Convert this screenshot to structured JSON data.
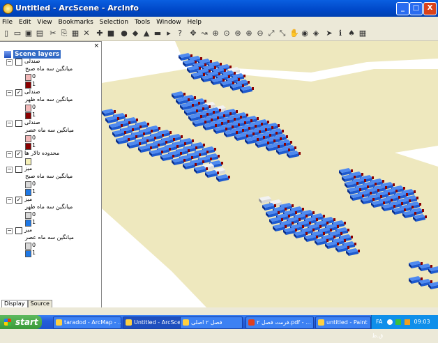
{
  "window": {
    "title": "Untitled - ArcScene - ArcInfo",
    "minimize": "_",
    "maximize": "□",
    "close": "X"
  },
  "menu": [
    "File",
    "Edit",
    "View",
    "Bookmarks",
    "Selection",
    "Tools",
    "Window",
    "Help"
  ],
  "toolbar": [
    "new-icon",
    "open-icon",
    "save-icon",
    "print-icon",
    "cut-icon",
    "copy-icon",
    "paste-icon",
    "delete-icon",
    "add-data-icon",
    "save-layer-icon",
    "globe-icon",
    "layers-icon",
    "layer-properties-icon",
    "animation-icon",
    "script-icon",
    "whats-this-icon",
    "navigate-icon",
    "fly-icon",
    "zoom-in-out-icon",
    "center-icon",
    "zoom-target-icon",
    "zoom-in-icon",
    "zoom-out-icon",
    "full-extent-icon",
    "fixed-extent-icon",
    "pan-icon",
    "globe-view-icon",
    "select-icon",
    "pointer-icon",
    "identify-icon",
    "find-icon",
    "measure-icon"
  ],
  "toc": {
    "close": "×",
    "root": "Scene layers",
    "items": [
      {
        "kind": "layer",
        "expand": "−",
        "checked": false,
        "name": "صندلی"
      },
      {
        "kind": "field",
        "name": "میانگین سه ماه صبح"
      },
      {
        "kind": "sym",
        "color": "#F2B8B8",
        "value": "0"
      },
      {
        "kind": "sym",
        "color": "#8B0000",
        "value": "1"
      },
      {
        "kind": "layer",
        "expand": "−",
        "checked": true,
        "name": "صندلی"
      },
      {
        "kind": "field",
        "name": "میانگین سه ماه ظهر"
      },
      {
        "kind": "sym",
        "color": "#F2B8B8",
        "value": "0"
      },
      {
        "kind": "sym",
        "color": "#8B0000",
        "value": "1"
      },
      {
        "kind": "layer",
        "expand": "−",
        "checked": false,
        "name": "صندلی"
      },
      {
        "kind": "field",
        "name": "میانگین سه ماه عصر"
      },
      {
        "kind": "sym",
        "color": "#F2B8B8",
        "value": "0"
      },
      {
        "kind": "sym",
        "color": "#8B0000",
        "value": "1"
      },
      {
        "kind": "layer",
        "expand": "−",
        "checked": true,
        "name": "محدوده تالار ها"
      },
      {
        "kind": "sym",
        "color": "#F5F0B8",
        "value": ""
      },
      {
        "kind": "layer",
        "expand": "−",
        "checked": false,
        "name": "میز"
      },
      {
        "kind": "field",
        "name": "میانگین سه ماه صبح"
      },
      {
        "kind": "sym",
        "color": "#D8D8D8",
        "value": "0"
      },
      {
        "kind": "sym",
        "color": "#1E78E6",
        "value": "1"
      },
      {
        "kind": "layer",
        "expand": "−",
        "checked": true,
        "name": "میز"
      },
      {
        "kind": "field",
        "name": "میانگین سه ماه ظهر"
      },
      {
        "kind": "sym",
        "color": "#D8D8D8",
        "value": "0"
      },
      {
        "kind": "sym",
        "color": "#1E78E6",
        "value": "1"
      },
      {
        "kind": "layer",
        "expand": "−",
        "checked": false,
        "name": "میز"
      },
      {
        "kind": "field",
        "name": "میانگین سه ماه عصر"
      },
      {
        "kind": "sym",
        "color": "#D8D8D8",
        "value": "0"
      },
      {
        "kind": "sym",
        "color": "#1E78E6",
        "value": "1"
      }
    ],
    "tabs": [
      "Display",
      "Source"
    ]
  },
  "scene": {
    "floor_color": "#EEE8BE",
    "desk_color": "#1E5ACF",
    "chair_color": "#8B0000",
    "inactive_desk_color": "#D8D8D8"
  },
  "taskbar": {
    "start": "start",
    "tasks": [
      {
        "label": "taradod - ArcMap - ...",
        "active": false
      },
      {
        "label": "Untitled - ArcScene ...",
        "active": true
      },
      {
        "label": "فصل ۲ اصلی",
        "active": false
      },
      {
        "label": "فرمت فصل ۲.pdf - ...",
        "active": false
      },
      {
        "label": "untitled - Paint",
        "active": false
      }
    ],
    "lang": "FA",
    "clock": "09:03 ق.ظ"
  }
}
